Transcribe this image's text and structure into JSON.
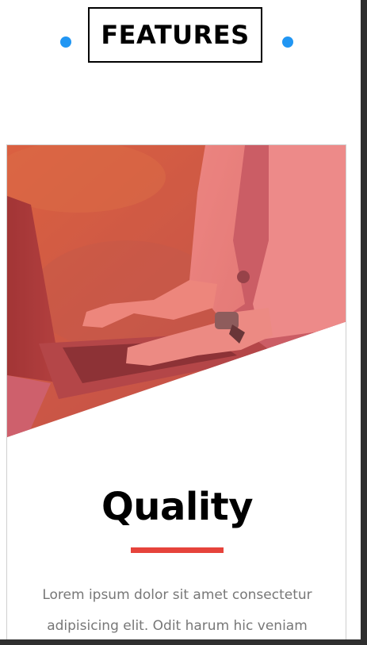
{
  "section": {
    "title": "FEATURES"
  },
  "card": {
    "title": "Quality",
    "body_line_1": "Lorem ipsum dolor sit amet consectetur",
    "body_line_2": "adipisicing elit. Odit harum hic veniam"
  },
  "colors": {
    "dot": "#2196f3",
    "accent_line": "#e6433b",
    "hero_overlay": "#e15347"
  }
}
